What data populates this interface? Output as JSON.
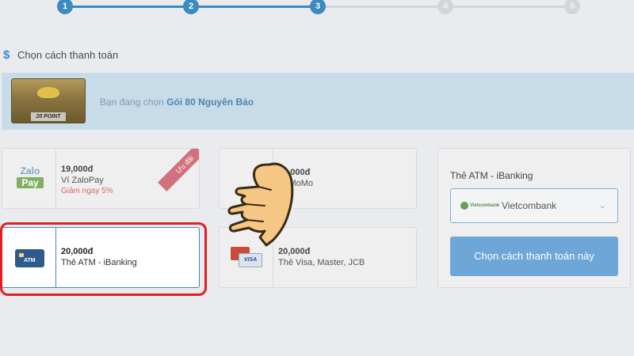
{
  "stepper": {
    "steps": [
      {
        "label": "1",
        "state": "done"
      },
      {
        "label": "2",
        "state": "done"
      },
      {
        "label": "3",
        "state": "current"
      },
      {
        "label": "4",
        "state": "todo"
      },
      {
        "label": "5",
        "state": "todo"
      }
    ]
  },
  "section": {
    "icon": "dollar-icon",
    "title": "Chọn cách thanh toán"
  },
  "banner": {
    "prefix": "Bạn đang chọn",
    "package_name": "Gói 80 Nguyên Bảo",
    "package_image": {
      "point_label": "20 POINT"
    }
  },
  "methods": [
    {
      "id": "zalopay",
      "logo_top": "Zalo",
      "logo_bottom": "Pay",
      "price": "19,000đ",
      "name": "Ví ZaloPay",
      "promo": "Giảm ngay 5%",
      "ribbon": "Ưu đãi"
    },
    {
      "id": "momo",
      "price": "20,000đ",
      "name": "Ví MoMo"
    },
    {
      "id": "atm",
      "logo_text": "ATM",
      "price": "20,000đ",
      "name": "Thẻ ATM - iBanking",
      "selected": true
    },
    {
      "id": "visa",
      "logo_text": "VISA",
      "price": "20,000đ",
      "name": "Thẻ Visa, Master, JCB"
    }
  ],
  "panel": {
    "label": "Thẻ ATM - iBanking",
    "bank_logo_text": "Vietcombank",
    "bank_selected": "Vietcombank",
    "confirm_label": "Chọn cách thanh toán này"
  },
  "colors": {
    "accent": "#3d89c2",
    "highlight": "#e02020",
    "promo": "#d9695f",
    "button": "#6ea6d8"
  }
}
